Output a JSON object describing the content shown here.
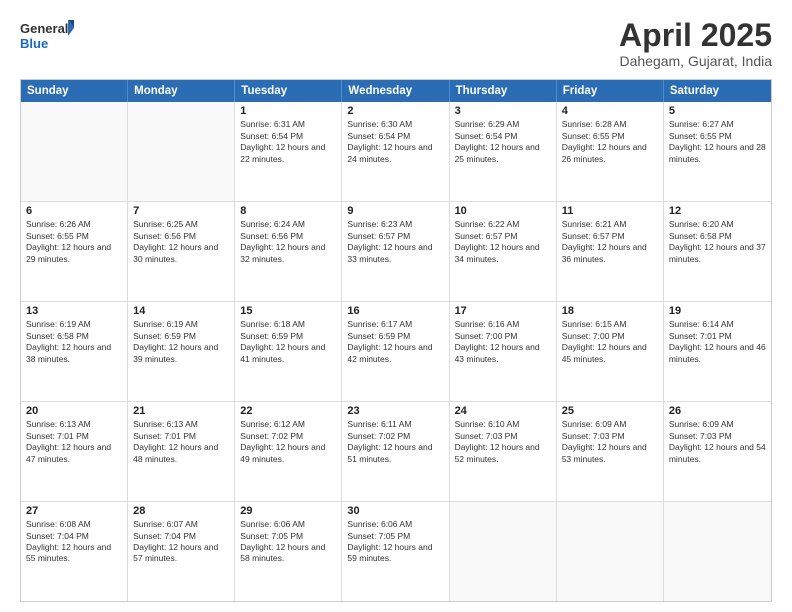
{
  "header": {
    "logo_general": "General",
    "logo_blue": "Blue",
    "title": "April 2025",
    "subtitle": "Dahegam, Gujarat, India"
  },
  "days_of_week": [
    "Sunday",
    "Monday",
    "Tuesday",
    "Wednesday",
    "Thursday",
    "Friday",
    "Saturday"
  ],
  "weeks": [
    [
      {
        "day": "",
        "sunrise": "",
        "sunset": "",
        "daylight": ""
      },
      {
        "day": "",
        "sunrise": "",
        "sunset": "",
        "daylight": ""
      },
      {
        "day": "1",
        "sunrise": "Sunrise: 6:31 AM",
        "sunset": "Sunset: 6:54 PM",
        "daylight": "Daylight: 12 hours and 22 minutes."
      },
      {
        "day": "2",
        "sunrise": "Sunrise: 6:30 AM",
        "sunset": "Sunset: 6:54 PM",
        "daylight": "Daylight: 12 hours and 24 minutes."
      },
      {
        "day": "3",
        "sunrise": "Sunrise: 6:29 AM",
        "sunset": "Sunset: 6:54 PM",
        "daylight": "Daylight: 12 hours and 25 minutes."
      },
      {
        "day": "4",
        "sunrise": "Sunrise: 6:28 AM",
        "sunset": "Sunset: 6:55 PM",
        "daylight": "Daylight: 12 hours and 26 minutes."
      },
      {
        "day": "5",
        "sunrise": "Sunrise: 6:27 AM",
        "sunset": "Sunset: 6:55 PM",
        "daylight": "Daylight: 12 hours and 28 minutes."
      }
    ],
    [
      {
        "day": "6",
        "sunrise": "Sunrise: 6:26 AM",
        "sunset": "Sunset: 6:55 PM",
        "daylight": "Daylight: 12 hours and 29 minutes."
      },
      {
        "day": "7",
        "sunrise": "Sunrise: 6:25 AM",
        "sunset": "Sunset: 6:56 PM",
        "daylight": "Daylight: 12 hours and 30 minutes."
      },
      {
        "day": "8",
        "sunrise": "Sunrise: 6:24 AM",
        "sunset": "Sunset: 6:56 PM",
        "daylight": "Daylight: 12 hours and 32 minutes."
      },
      {
        "day": "9",
        "sunrise": "Sunrise: 6:23 AM",
        "sunset": "Sunset: 6:57 PM",
        "daylight": "Daylight: 12 hours and 33 minutes."
      },
      {
        "day": "10",
        "sunrise": "Sunrise: 6:22 AM",
        "sunset": "Sunset: 6:57 PM",
        "daylight": "Daylight: 12 hours and 34 minutes."
      },
      {
        "day": "11",
        "sunrise": "Sunrise: 6:21 AM",
        "sunset": "Sunset: 6:57 PM",
        "daylight": "Daylight: 12 hours and 36 minutes."
      },
      {
        "day": "12",
        "sunrise": "Sunrise: 6:20 AM",
        "sunset": "Sunset: 6:58 PM",
        "daylight": "Daylight: 12 hours and 37 minutes."
      }
    ],
    [
      {
        "day": "13",
        "sunrise": "Sunrise: 6:19 AM",
        "sunset": "Sunset: 6:58 PM",
        "daylight": "Daylight: 12 hours and 38 minutes."
      },
      {
        "day": "14",
        "sunrise": "Sunrise: 6:19 AM",
        "sunset": "Sunset: 6:59 PM",
        "daylight": "Daylight: 12 hours and 39 minutes."
      },
      {
        "day": "15",
        "sunrise": "Sunrise: 6:18 AM",
        "sunset": "Sunset: 6:59 PM",
        "daylight": "Daylight: 12 hours and 41 minutes."
      },
      {
        "day": "16",
        "sunrise": "Sunrise: 6:17 AM",
        "sunset": "Sunset: 6:59 PM",
        "daylight": "Daylight: 12 hours and 42 minutes."
      },
      {
        "day": "17",
        "sunrise": "Sunrise: 6:16 AM",
        "sunset": "Sunset: 7:00 PM",
        "daylight": "Daylight: 12 hours and 43 minutes."
      },
      {
        "day": "18",
        "sunrise": "Sunrise: 6:15 AM",
        "sunset": "Sunset: 7:00 PM",
        "daylight": "Daylight: 12 hours and 45 minutes."
      },
      {
        "day": "19",
        "sunrise": "Sunrise: 6:14 AM",
        "sunset": "Sunset: 7:01 PM",
        "daylight": "Daylight: 12 hours and 46 minutes."
      }
    ],
    [
      {
        "day": "20",
        "sunrise": "Sunrise: 6:13 AM",
        "sunset": "Sunset: 7:01 PM",
        "daylight": "Daylight: 12 hours and 47 minutes."
      },
      {
        "day": "21",
        "sunrise": "Sunrise: 6:13 AM",
        "sunset": "Sunset: 7:01 PM",
        "daylight": "Daylight: 12 hours and 48 minutes."
      },
      {
        "day": "22",
        "sunrise": "Sunrise: 6:12 AM",
        "sunset": "Sunset: 7:02 PM",
        "daylight": "Daylight: 12 hours and 49 minutes."
      },
      {
        "day": "23",
        "sunrise": "Sunrise: 6:11 AM",
        "sunset": "Sunset: 7:02 PM",
        "daylight": "Daylight: 12 hours and 51 minutes."
      },
      {
        "day": "24",
        "sunrise": "Sunrise: 6:10 AM",
        "sunset": "Sunset: 7:03 PM",
        "daylight": "Daylight: 12 hours and 52 minutes."
      },
      {
        "day": "25",
        "sunrise": "Sunrise: 6:09 AM",
        "sunset": "Sunset: 7:03 PM",
        "daylight": "Daylight: 12 hours and 53 minutes."
      },
      {
        "day": "26",
        "sunrise": "Sunrise: 6:09 AM",
        "sunset": "Sunset: 7:03 PM",
        "daylight": "Daylight: 12 hours and 54 minutes."
      }
    ],
    [
      {
        "day": "27",
        "sunrise": "Sunrise: 6:08 AM",
        "sunset": "Sunset: 7:04 PM",
        "daylight": "Daylight: 12 hours and 55 minutes."
      },
      {
        "day": "28",
        "sunrise": "Sunrise: 6:07 AM",
        "sunset": "Sunset: 7:04 PM",
        "daylight": "Daylight: 12 hours and 57 minutes."
      },
      {
        "day": "29",
        "sunrise": "Sunrise: 6:06 AM",
        "sunset": "Sunset: 7:05 PM",
        "daylight": "Daylight: 12 hours and 58 minutes."
      },
      {
        "day": "30",
        "sunrise": "Sunrise: 6:06 AM",
        "sunset": "Sunset: 7:05 PM",
        "daylight": "Daylight: 12 hours and 59 minutes."
      },
      {
        "day": "",
        "sunrise": "",
        "sunset": "",
        "daylight": ""
      },
      {
        "day": "",
        "sunrise": "",
        "sunset": "",
        "daylight": ""
      },
      {
        "day": "",
        "sunrise": "",
        "sunset": "",
        "daylight": ""
      }
    ]
  ]
}
